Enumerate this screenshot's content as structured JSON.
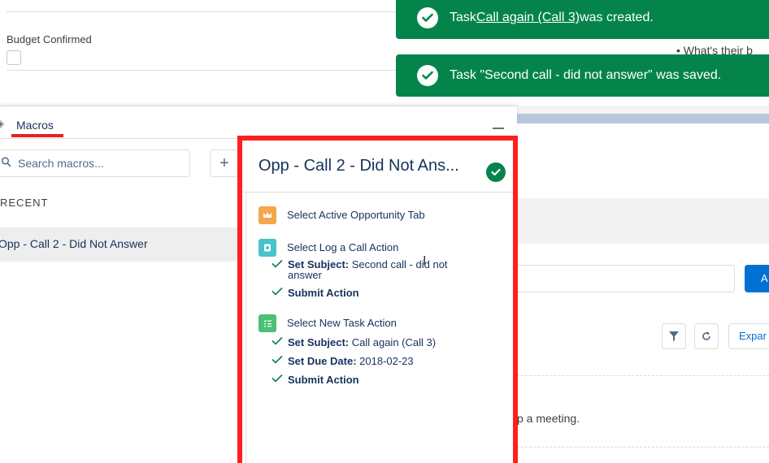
{
  "record": {
    "field_label": "Budget Confirmed",
    "bullet_text": "• What's their b",
    "meeting_text": "p a meeting.",
    "add_button_label": "A",
    "expand_label": "Expar"
  },
  "toasts": [
    {
      "prefix": "Task ",
      "link": "Call again (Call 3)",
      "suffix": " was created."
    },
    {
      "prefix": "Task \"Second call - did not answer\" was saved.",
      "link": "",
      "suffix": ""
    }
  ],
  "macros": {
    "title": "Macros",
    "search": {
      "placeholder": "Search macros..."
    },
    "add_label": "+",
    "recent_label": "RECENT",
    "recent_items": [
      "Opp - Call 2 - Did Not Answer"
    ]
  },
  "detail": {
    "title": "Opp - Call 2 - Did Not Ans...",
    "steps": [
      {
        "label": "Select Active Opportunity Tab",
        "icon": "crown-icon",
        "color": "#f4a64a",
        "subs": []
      },
      {
        "label": "Select Log a Call Action",
        "icon": "call-log-icon",
        "color": "#48c3cc",
        "subs": [
          {
            "key": "Set Subject:",
            "value": " Second call - did not answer"
          },
          {
            "key": "Submit Action",
            "value": ""
          }
        ]
      },
      {
        "label": "Select New Task Action",
        "icon": "task-list-icon",
        "color": "#4bc076",
        "subs": [
          {
            "key": "Set Subject:",
            "value": " Call again (Call 3)"
          },
          {
            "key": "Set Due Date:",
            "value": " 2018-02-23"
          },
          {
            "key": "Submit Action",
            "value": ""
          }
        ]
      }
    ]
  },
  "colors": {
    "toast": "#04844b",
    "highlight": "#ff1f1f",
    "brand": "#0070d2"
  }
}
